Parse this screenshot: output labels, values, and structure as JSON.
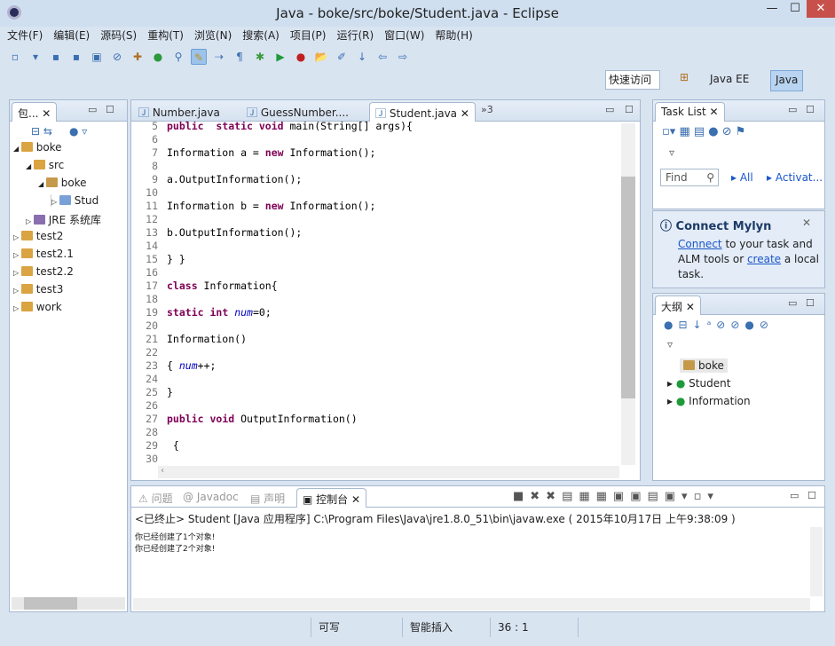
{
  "window": {
    "title": "Java  -  boke/src/boke/Student.java  -  Eclipse",
    "minimize": "—",
    "maximize": "☐",
    "close": "✕"
  },
  "menu": [
    "文件(F)",
    "编辑(E)",
    "源码(S)",
    "重构(T)",
    "浏览(N)",
    "搜索(A)",
    "项目(P)",
    "运行(R)",
    "窗口(W)",
    "帮助(H)"
  ],
  "toolbar": {
    "quick_access": "快速访问",
    "perspectives": [
      "Java EE",
      "Java"
    ]
  },
  "package_explorer": {
    "tab": "包...",
    "tree": [
      {
        "label": "boke",
        "depth": 0,
        "icon": "project-icon"
      },
      {
        "label": "src",
        "depth": 1,
        "icon": "source-folder-icon"
      },
      {
        "label": "boke",
        "depth": 2,
        "icon": "package-icon"
      },
      {
        "label": "Stud",
        "depth": 3,
        "icon": "java-file-icon"
      },
      {
        "label": "JRE 系统库",
        "depth": 1,
        "icon": "library-icon"
      },
      {
        "label": "test2",
        "depth": 0,
        "icon": "project-icon"
      },
      {
        "label": "test2.1",
        "depth": 0,
        "icon": "project-icon"
      },
      {
        "label": "test2.2",
        "depth": 0,
        "icon": "project-icon"
      },
      {
        "label": "test3",
        "depth": 0,
        "icon": "project-icon"
      },
      {
        "label": "work",
        "depth": 0,
        "icon": "project-icon"
      }
    ]
  },
  "editor": {
    "tabs": [
      "Number.java",
      "GuessNumber....",
      "Student.java"
    ],
    "active_tab": 2,
    "overflow": "»3",
    "lines": [
      {
        "n": "5",
        "s": [
          [
            "kw",
            "public"
          ],
          [
            "",
            "  "
          ],
          [
            "kw",
            "static"
          ],
          [
            "",
            ""
          ],
          [
            "kw",
            " void"
          ],
          [
            "",
            " main(String[] args){"
          ]
        ]
      },
      {
        "n": "6",
        "s": []
      },
      {
        "n": "7",
        "s": [
          [
            "",
            "Information a = "
          ],
          [
            "kw",
            "new"
          ],
          [
            "",
            " Information();"
          ]
        ]
      },
      {
        "n": "8",
        "s": []
      },
      {
        "n": "9",
        "s": [
          [
            "",
            "a.OutputInformation();"
          ]
        ]
      },
      {
        "n": "10",
        "s": []
      },
      {
        "n": "11",
        "s": [
          [
            "",
            "Information b = "
          ],
          [
            "kw",
            "new"
          ],
          [
            "",
            " Information();"
          ]
        ]
      },
      {
        "n": "12",
        "s": []
      },
      {
        "n": "13",
        "s": [
          [
            "",
            "b.OutputInformation();"
          ]
        ]
      },
      {
        "n": "14",
        "s": []
      },
      {
        "n": "15",
        "s": [
          [
            "",
            "} }"
          ]
        ]
      },
      {
        "n": "16",
        "s": []
      },
      {
        "n": "17",
        "s": [
          [
            "kw",
            "class"
          ],
          [
            "",
            " Information{"
          ]
        ]
      },
      {
        "n": "18",
        "s": []
      },
      {
        "n": "19",
        "s": [
          [
            "kw",
            "static"
          ],
          [
            "kw",
            " int"
          ],
          [
            "",
            " "
          ],
          [
            "st",
            "num"
          ],
          [
            "",
            "=0;"
          ]
        ]
      },
      {
        "n": "20",
        "s": []
      },
      {
        "n": "21",
        "s": [
          [
            "",
            "Information()"
          ]
        ]
      },
      {
        "n": "22",
        "s": []
      },
      {
        "n": "23",
        "s": [
          [
            "",
            "{ "
          ],
          [
            "st",
            "num"
          ],
          [
            "",
            "++;"
          ]
        ]
      },
      {
        "n": "24",
        "s": []
      },
      {
        "n": "25",
        "s": [
          [
            "",
            "}"
          ]
        ]
      },
      {
        "n": "26",
        "s": []
      },
      {
        "n": "27",
        "s": [
          [
            "kw",
            "public"
          ],
          [
            "kw",
            " void"
          ],
          [
            "",
            " OutputInformation()"
          ]
        ]
      },
      {
        "n": "28",
        "s": []
      },
      {
        "n": "29",
        "s": [
          [
            "",
            " {"
          ]
        ]
      },
      {
        "n": "30",
        "s": []
      }
    ]
  },
  "task_list": {
    "tab": "Task List",
    "find_placeholder": "Find",
    "all": "All",
    "activate": "Activat..."
  },
  "mylyn": {
    "title": "Connect Mylyn",
    "link1": "Connect",
    "text1": " to your task and ALM tools or ",
    "link2": "create",
    "text2": " a local task."
  },
  "outline": {
    "tab": "大纲",
    "items": [
      "boke",
      "Student",
      "Information"
    ]
  },
  "console": {
    "tabs": [
      "问题",
      "Javadoc",
      "声明",
      "控制台"
    ],
    "header": "<已终止> Student [Java 应用程序] C:\\Program Files\\Java\\jre1.8.0_51\\bin\\javaw.exe ( 2015年10月17日 上午9:38:09 )",
    "output": [
      "你已经创建了1个对象!",
      "你已经创建了2个对象!"
    ]
  },
  "status": {
    "writable": "可写",
    "insert_mode": "智能插入",
    "position": "36 : 1"
  }
}
